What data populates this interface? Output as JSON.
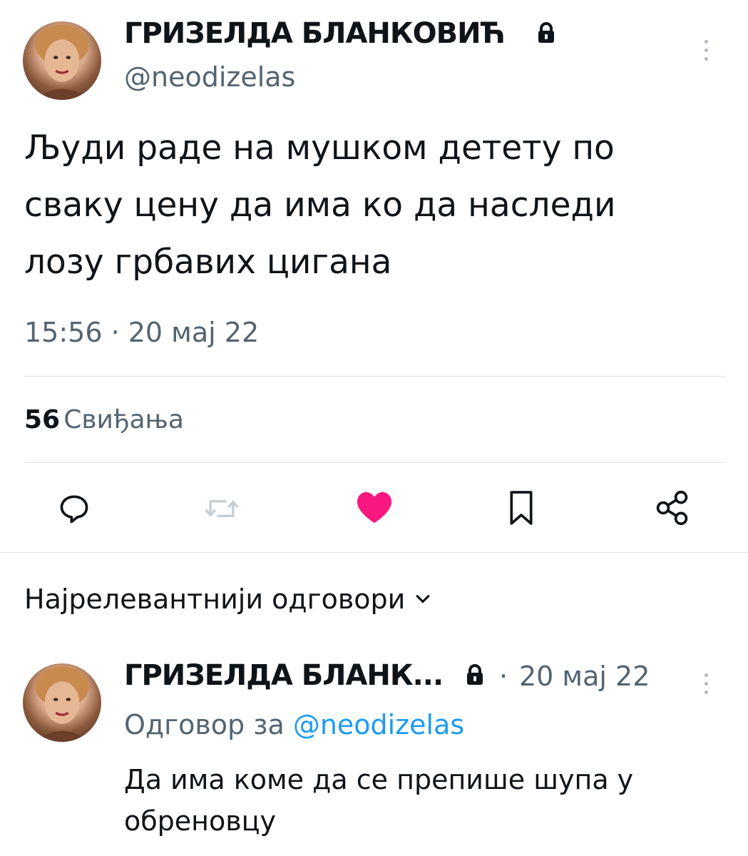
{
  "tweet": {
    "author_name": "ГРИЗЕЛДА БЛАНКОВИЋ",
    "handle": "@neodizelas",
    "text": "Људи раде на мушком детету по сваку цену да има ко да наследи лозу грбавих цигана",
    "timestamp": "15:56 · 20 мај 22",
    "likes_count": "56",
    "likes_label": "Свиђања",
    "liked": true,
    "icons": {
      "lock": "lock-icon",
      "more": "more-vertical-icon",
      "reply": "reply-icon",
      "retweet": "retweet-icon",
      "like": "heart-icon",
      "bookmark": "bookmark-icon",
      "share": "share-icon"
    }
  },
  "replies_section": {
    "title": "Најрелевантнији одговори",
    "dropdown_icon": "chevron-down-icon"
  },
  "reply": {
    "author_name": "ГРИЗЕЛДА БЛАНК...",
    "date": "20 мај 22",
    "replying_to_prefix": "Одговор за",
    "replying_to_handle": "@neodizelas",
    "text": "Да има коме да се препише шупа у обреновцу"
  },
  "colors": {
    "like_active": "#f91880",
    "link": "#1d9bf0",
    "secondary_text": "#536471",
    "primary_text": "#0f1419"
  }
}
